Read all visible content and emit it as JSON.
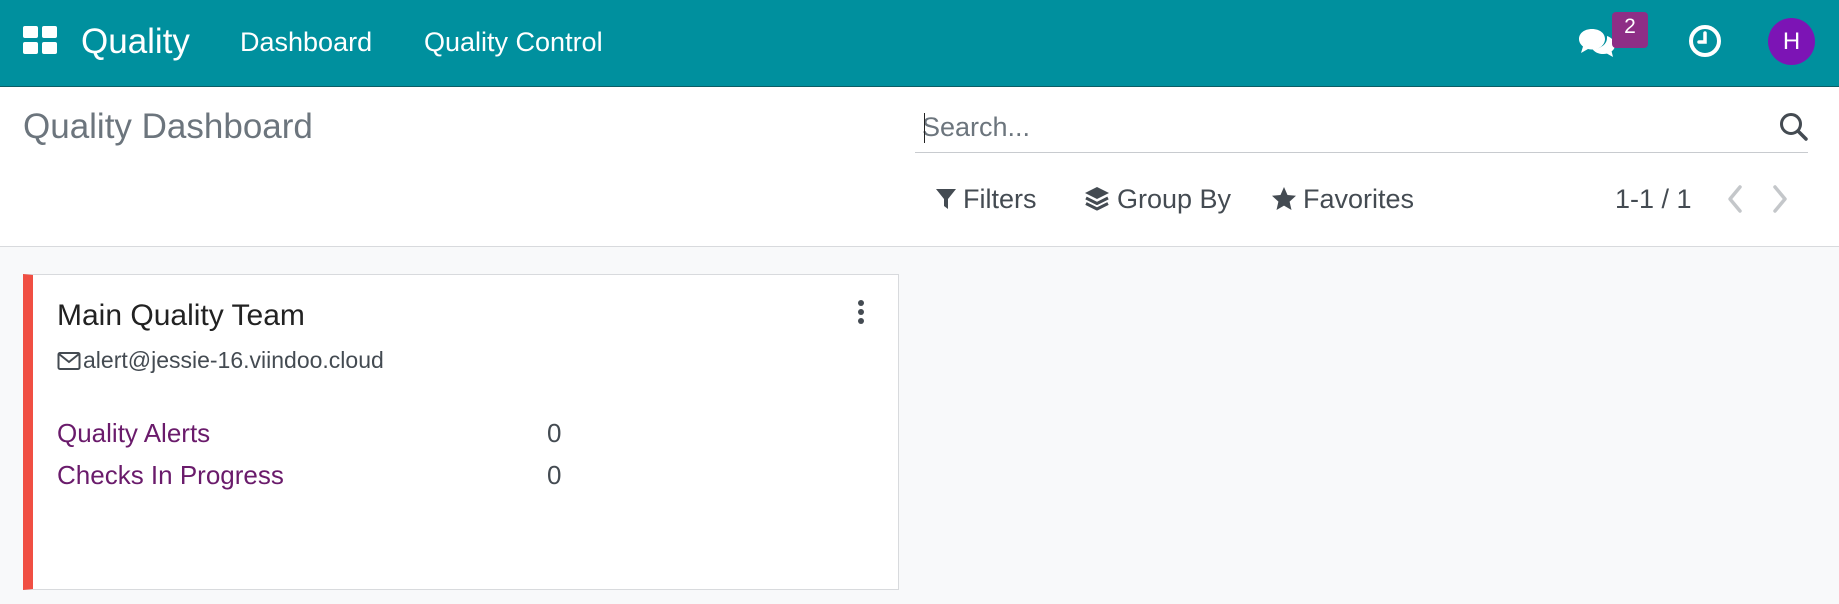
{
  "navbar": {
    "app_name": "Quality",
    "menus": [
      "Dashboard",
      "Quality Control"
    ],
    "chat_count": "2",
    "avatar_initial": "H",
    "colors": {
      "background": "#00909e",
      "badge": "#8e2e86",
      "avatar": "#7c14b5"
    },
    "icons": [
      "apps-grid-icon",
      "chat-icon",
      "clock-icon"
    ]
  },
  "control_panel": {
    "title": "Quality Dashboard",
    "search_placeholder": "Search...",
    "filters_label": "Filters",
    "groupby_label": "Group By",
    "favorites_label": "Favorites",
    "pager": "1-1 / 1",
    "icons": [
      "search-icon",
      "filter-icon",
      "layers-icon",
      "star-icon",
      "chevron-left-icon",
      "chevron-right-icon"
    ]
  },
  "kanban": {
    "card": {
      "name": "Main Quality Team",
      "email": "alert@jessie-16.viindoo.cloud",
      "accent_color": "#f04f43",
      "stats": [
        {
          "label": "Quality Alerts",
          "value": "0"
        },
        {
          "label": "Checks In Progress",
          "value": "0"
        }
      ]
    }
  }
}
